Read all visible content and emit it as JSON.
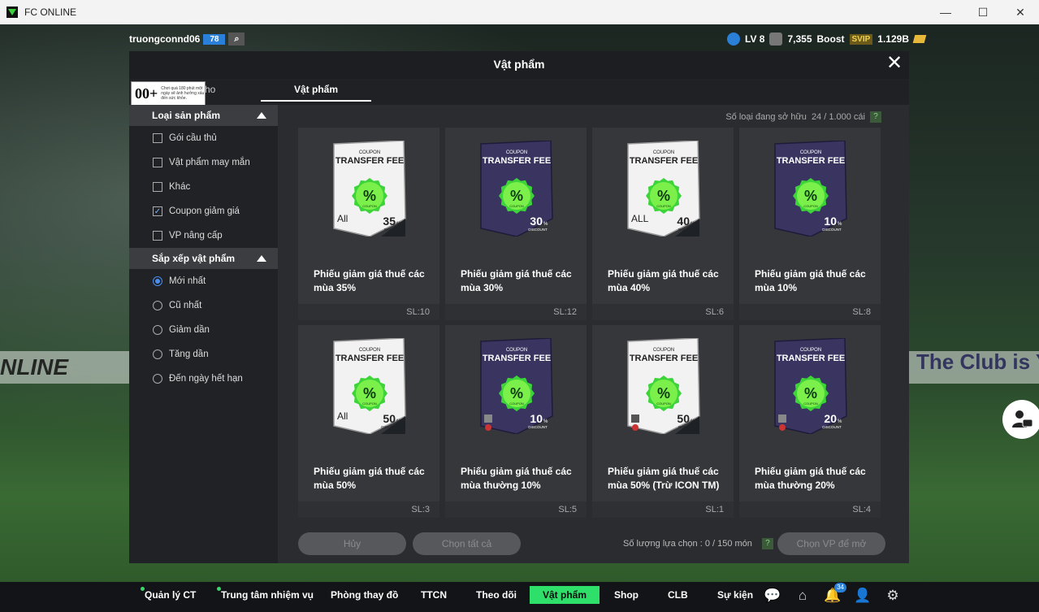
{
  "window": {
    "title": "FC ONLINE",
    "minimize": "—",
    "maximize": "☐",
    "close": "✕"
  },
  "background": {
    "banner_left": "NLINE",
    "banner_right": "The Club is Y"
  },
  "hud": {
    "username": "truongconnd06",
    "user_badge": "78",
    "level": "LV 8",
    "points": "7,355",
    "boost": "Boost",
    "svip": "SVIP",
    "coins": "1.129B"
  },
  "modal": {
    "title": "Vật phẩm",
    "tabs": {
      "kho": "Kho",
      "vat_pham": "Vật phẩm"
    },
    "age_rating": {
      "number": "00+",
      "text": "Chơi quá 180 phút một ngày sẽ ảnh hưởng xấu đến sức khỏe."
    },
    "owned_label": "Số loại đang sở hữu",
    "owned_value": "24 / 1.000 cái",
    "help": "?"
  },
  "sidebar": {
    "product_type_header": "Loại sản phẩm",
    "product_types": [
      {
        "label": "Gói cầu thủ",
        "checked": false
      },
      {
        "label": "Vật phẩm may mắn",
        "checked": false
      },
      {
        "label": "Khác",
        "checked": false
      },
      {
        "label": "Coupon giảm giá",
        "checked": true
      },
      {
        "label": "VP nâng cấp",
        "checked": false
      }
    ],
    "sort_header": "Sắp xếp vật phẩm",
    "sort_options": [
      {
        "label": "Mới nhất",
        "selected": true
      },
      {
        "label": "Cũ nhất",
        "selected": false
      },
      {
        "label": "Giảm dần",
        "selected": false
      },
      {
        "label": "Tăng dần",
        "selected": false
      },
      {
        "label": "Đến ngày hết hạn",
        "selected": false
      }
    ]
  },
  "coupon_text": {
    "top": "COUPON",
    "fee": "TRANSFER FEE",
    "badge": "%",
    "badge_sub": "COUPON"
  },
  "items": [
    {
      "name": "Phiếu giảm giá thuế các mùa 35%",
      "qty": "SL:10",
      "style": "white",
      "pct": "35",
      "kind": "BONUS",
      "corner": "All"
    },
    {
      "name": "Phiếu giảm giá thuế các mùa 30%",
      "qty": "SL:12",
      "style": "dark",
      "pct": "30",
      "kind": "DISCOUNT",
      "corner": ""
    },
    {
      "name": "Phiếu giảm giá thuế các mùa 40%",
      "qty": "SL:6",
      "style": "white",
      "pct": "40",
      "kind": "BONUS",
      "corner": "ALL"
    },
    {
      "name": "Phiếu giảm giá thuế các mùa 10%",
      "qty": "SL:8",
      "style": "dark",
      "pct": "10",
      "kind": "DISCOUNT",
      "corner": ""
    },
    {
      "name": "Phiếu giảm giá thuế các mùa 50%",
      "qty": "SL:3",
      "style": "white",
      "pct": "50",
      "kind": "DISCOUNT",
      "corner": "All"
    },
    {
      "name": "Phiếu giảm giá thuế các mùa thường 10%",
      "qty": "SL:5",
      "style": "dark",
      "pct": "10",
      "kind": "DISCOUNT",
      "corner": "icon"
    },
    {
      "name": "Phiếu giảm giá thuế các mùa 50% (Trừ ICON TM)",
      "qty": "SL:1",
      "style": "white",
      "pct": "50",
      "kind": "BONUS",
      "corner": "icon"
    },
    {
      "name": "Phiếu giảm giá thuế các mùa thường 20%",
      "qty": "SL:4",
      "style": "dark",
      "pct": "20",
      "kind": "DISCOUNT",
      "corner": "icon"
    }
  ],
  "actions": {
    "cancel": "Hủy",
    "select_all": "Chọn tất cả",
    "select_count_label": "Số lượng lựa chọn : 0 / 150 món",
    "select_vp": "Chọn VP để mở"
  },
  "bottom_nav": {
    "items": [
      "Quản lý CT",
      "Trung tâm nhiệm vụ",
      "Phòng thay đồ",
      "TTCN",
      "Theo dõi",
      "Vật phẩm",
      "Shop",
      "CLB",
      "Sự kiện"
    ],
    "notification_count": "34"
  },
  "colors": {
    "accent_green": "#2ee06a",
    "badge_blue": "#2a7fd8",
    "coupon_green": "#3dd43a"
  }
}
